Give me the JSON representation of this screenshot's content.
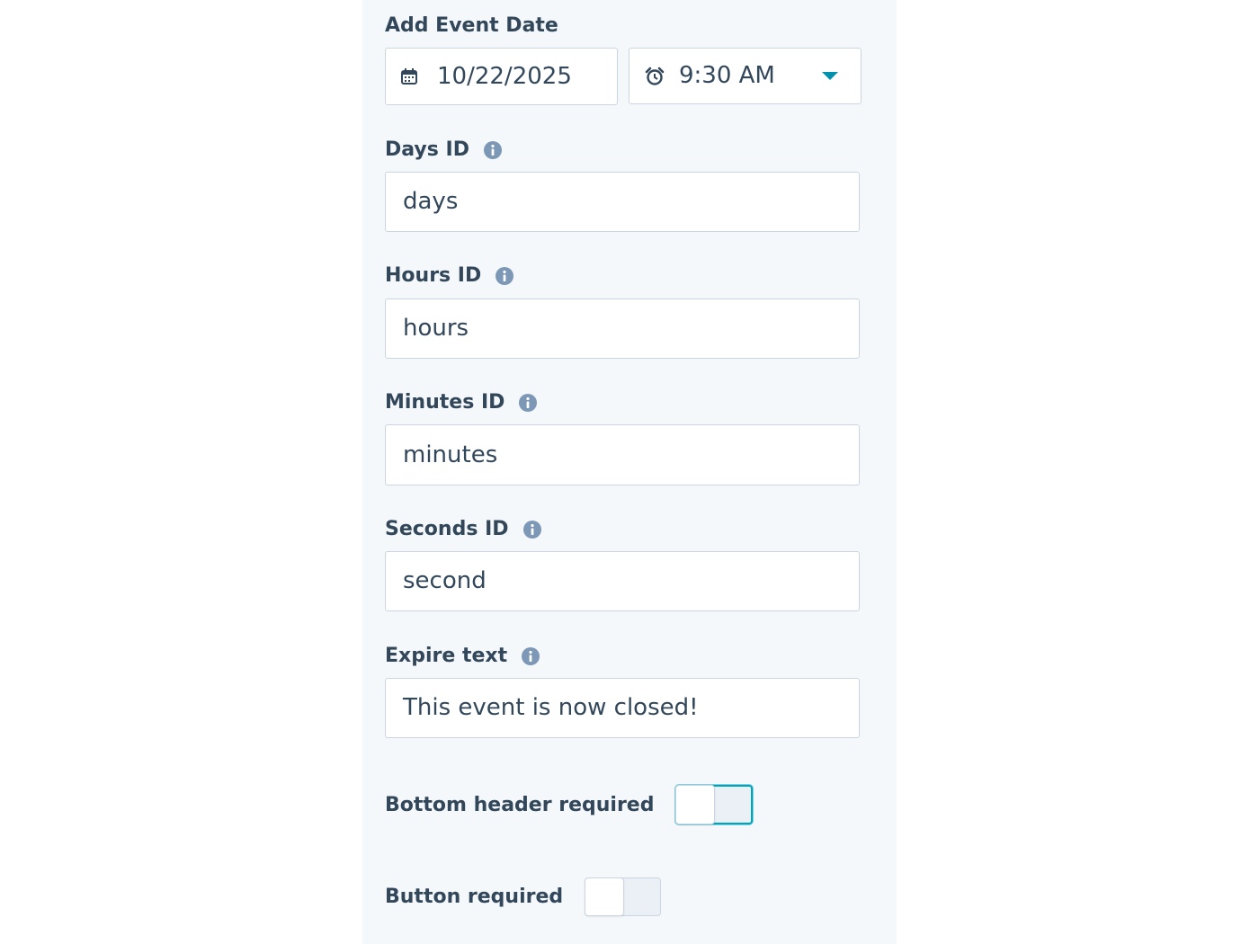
{
  "event_date": {
    "label": "Add Event Date",
    "date_value": "10/22/2025",
    "time_value": "9:30 AM"
  },
  "fields": [
    {
      "label": "Days ID",
      "value": "days"
    },
    {
      "label": "Hours ID",
      "value": "hours"
    },
    {
      "label": "Minutes ID",
      "value": "minutes"
    },
    {
      "label": "Seconds ID",
      "value": "second"
    },
    {
      "label": "Expire text",
      "value": "This event is now closed!"
    }
  ],
  "toggles": [
    {
      "label": "Bottom header required",
      "state": "off",
      "focused": true
    },
    {
      "label": "Button required",
      "state": "off",
      "focused": false
    }
  ],
  "icons": {
    "date": "calendar-icon",
    "time": "alarm-clock-icon",
    "dropdown": "caret-down-icon",
    "info": "info-icon"
  },
  "colors": {
    "panel_bg": "#f5f8fa",
    "text": "#33475b",
    "border": "#cbd6e2",
    "accent": "#0091ae",
    "info_icon": "#7c98b6"
  }
}
